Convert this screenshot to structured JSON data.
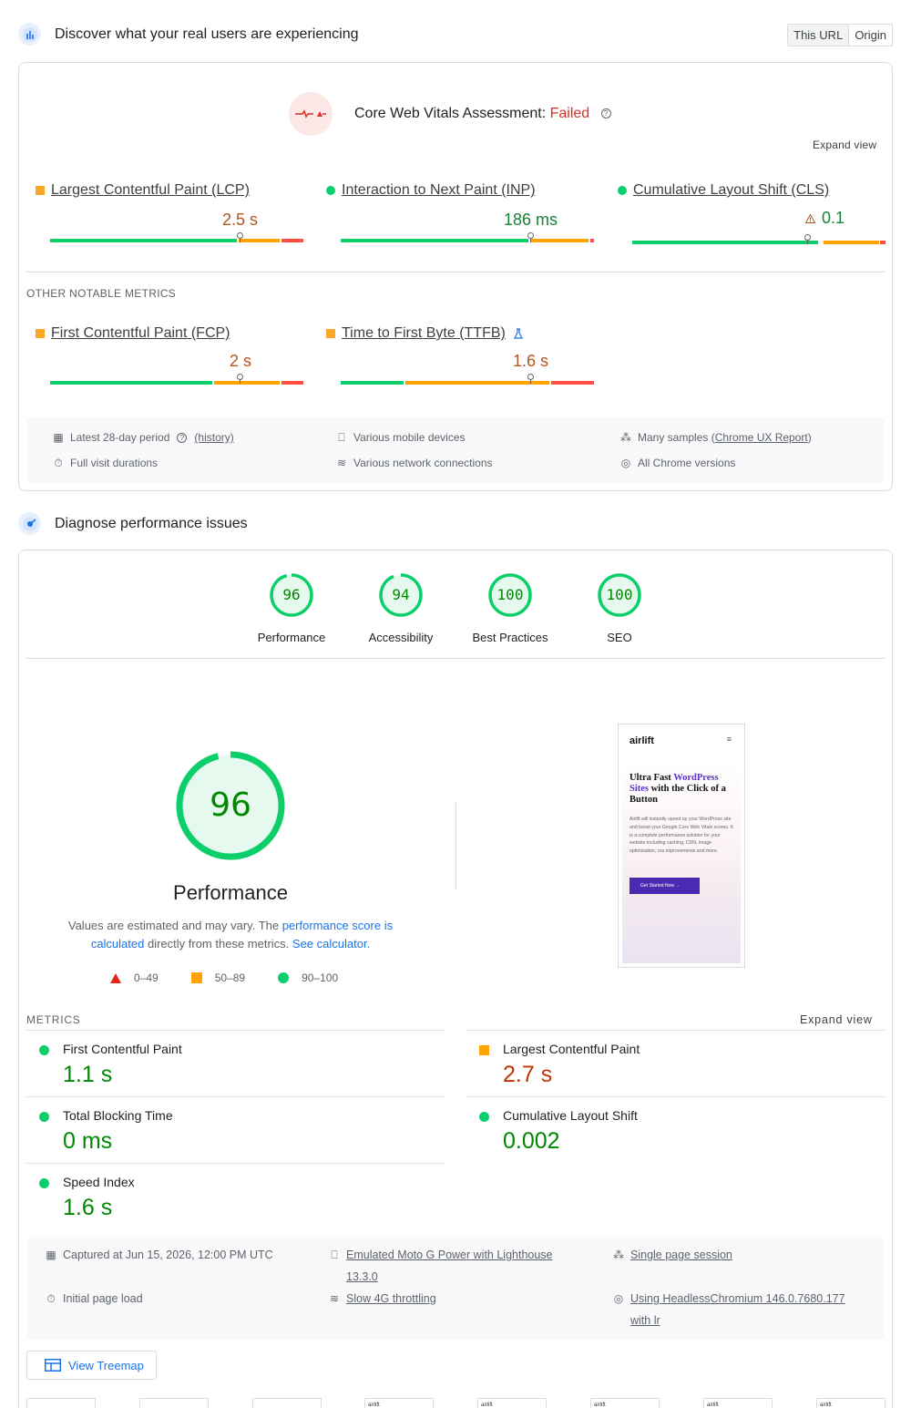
{
  "crux": {
    "heading": "Discover what your real users are experiencing",
    "toggle": [
      "This URL",
      "Origin"
    ],
    "assessment_label": "Core Web Vitals Assessment:",
    "assessment_status": "Failed",
    "help": "?",
    "expand": "Expand view",
    "core_metrics": [
      {
        "label": "Largest Contentful Paint (LCP)",
        "value": "2.5 s",
        "status": "needs-improvement"
      },
      {
        "label": "Interaction to Next Paint (INP)",
        "value": "186 ms",
        "status": "good"
      },
      {
        "label": "Cumulative Layout Shift (CLS)",
        "value": "0.1",
        "status": "good"
      }
    ],
    "other_title": "OTHER NOTABLE METRICS",
    "other_metrics": [
      {
        "label": "First Contentful Paint (FCP)",
        "value": "2 s",
        "status": "needs-improvement"
      },
      {
        "label": "Time to First Byte (TTFB)",
        "value": "1.6 s",
        "status": "needs-improvement"
      }
    ],
    "info": {
      "period": "Latest 28-day period",
      "history": "(history)",
      "devices": "Various mobile devices",
      "samples_prefix": "Many samples (",
      "samples_link": "Chrome UX Report",
      "samples_suffix": ")",
      "durations": "Full visit durations",
      "network": "Various network connections",
      "versions": "All Chrome versions"
    }
  },
  "lighthouse": {
    "heading": "Diagnose performance issues",
    "categories": [
      {
        "label": "Performance",
        "score": "96"
      },
      {
        "label": "Accessibility",
        "score": "94"
      },
      {
        "label": "Best Practices",
        "score": "100"
      },
      {
        "label": "SEO",
        "score": "100"
      }
    ],
    "big_score": "96",
    "big_title": "Performance",
    "desc_1": "Values are estimated and may vary. The ",
    "desc_link1": "performance score is calculated",
    "desc_2": " directly from these metrics. ",
    "desc_link2": "See calculator.",
    "legend": [
      "0–49",
      "50–89",
      "90–100"
    ],
    "screenshot": {
      "logo": "airlift",
      "menu": "≡",
      "headline_1": "Ultra Fast ",
      "headline_2": "WordPress Sites",
      "headline_3": " with the Click of a Button",
      "paragraph": "Airlift will instantly speed up your WordPress site and boost your Google Core Web Vitals scores. It is a complete performance solution for your website including caching, CDN, image optimization, css improvements and more.",
      "button": "Get Started Now →"
    },
    "metrics_title": "METRICS",
    "expand": "Expand view",
    "metrics": [
      {
        "label": "First Contentful Paint",
        "value": "1.1 s",
        "status": "good"
      },
      {
        "label": "Largest Contentful Paint",
        "value": "2.7 s",
        "status": "average"
      },
      {
        "label": "Total Blocking Time",
        "value": "0 ms",
        "status": "good"
      },
      {
        "label": "Cumulative Layout Shift",
        "value": "0.002",
        "status": "good"
      },
      {
        "label": "Speed Index",
        "value": "1.6 s",
        "status": "good"
      }
    ],
    "env": {
      "captured": "Captured at Jun 15, 2026, 12:00 PM UTC",
      "device_1": "Emulated Moto G Power with Lighthouse",
      "device_2": "13.3.0",
      "session": "Single page session",
      "load": "Initial page load",
      "throttling": "Slow 4G throttling",
      "browser_1": "Using HeadlessChromium 146.0.7680.177",
      "browser_2": "with lr"
    },
    "treemap": "View Treemap",
    "filmstrip_logo": "airlift"
  },
  "colors": {
    "good": "#0cce6b",
    "average": "#ffa400",
    "poor": "#ff4e42",
    "failed": "#d93025",
    "link": "#1a73e8"
  }
}
